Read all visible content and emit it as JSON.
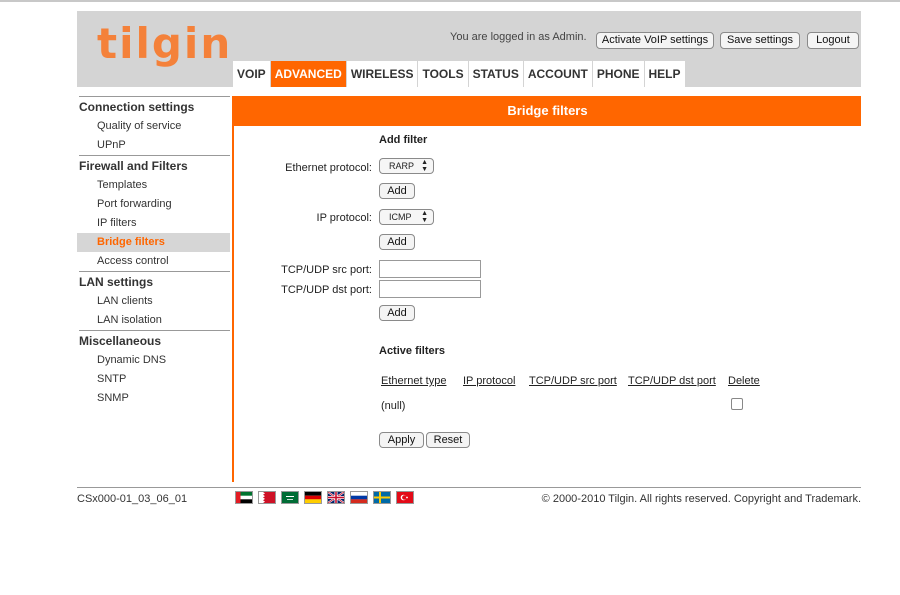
{
  "header": {
    "logo": "tilgin",
    "logged_in": "You are logged in as Admin.",
    "buttons": {
      "activate_voip": "Activate VoIP settings",
      "save_settings": "Save settings",
      "logout": "Logout"
    }
  },
  "nav": {
    "tabs": [
      "VOIP",
      "ADVANCED",
      "WIRELESS",
      "TOOLS",
      "STATUS",
      "ACCOUNT",
      "PHONE",
      "HELP"
    ],
    "active": "ADVANCED"
  },
  "sidebar": {
    "groups": [
      {
        "title": "Connection settings",
        "items": [
          "Quality of service",
          "UPnP"
        ]
      },
      {
        "title": "Firewall and Filters",
        "items": [
          "Templates",
          "Port forwarding",
          "IP filters",
          "Bridge filters",
          "Access control"
        ]
      },
      {
        "title": "LAN settings",
        "items": [
          "LAN clients",
          "LAN isolation"
        ]
      },
      {
        "title": "Miscellaneous",
        "items": [
          "Dynamic DNS",
          "SNTP",
          "SNMP"
        ]
      }
    ],
    "active_item": "Bridge filters"
  },
  "page_title": "Bridge filters",
  "add_filter": {
    "title": "Add filter",
    "ethernet_protocol_label": "Ethernet protocol:",
    "ethernet_protocol_value": "RARP",
    "ip_protocol_label": "IP protocol:",
    "ip_protocol_value": "ICMP",
    "src_port_label": "TCP/UDP src port:",
    "dst_port_label": "TCP/UDP dst port:",
    "add_label": "Add"
  },
  "active_filters": {
    "title": "Active filters",
    "columns": [
      "Ethernet type",
      "IP protocol",
      "TCP/UDP src port",
      "TCP/UDP dst port",
      "Delete"
    ],
    "rows": [
      {
        "ethernet_type": "(null)"
      }
    ],
    "apply_label": "Apply",
    "reset_label": "Reset"
  },
  "footer": {
    "version": "CSx000-01_03_06_01",
    "copyright": "© 2000-2010 Tilgin. All rights reserved. Copyright and Trademark.",
    "flags": [
      "uae-flag",
      "bahrain-flag",
      "saudi-flag",
      "germany-flag",
      "uk-flag",
      "russia-flag",
      "sweden-flag",
      "turkey-flag"
    ]
  },
  "colors": {
    "accent": "#ff6600",
    "header_bg": "#d4d4d4",
    "logo": "#f4813a"
  }
}
